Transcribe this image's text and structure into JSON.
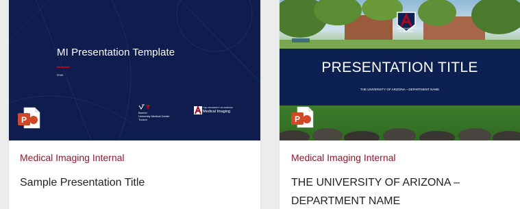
{
  "cards": [
    {
      "thumbnail": {
        "title": "MI Presentation Template",
        "date": "Date",
        "logos": {
          "banner": "Banner\nUniversity Medical Center\nTucson",
          "mi_small": "THE UNIVERSITY OF ARIZONA",
          "mi_big": "Medical Imaging"
        }
      },
      "category": "Medical Imaging Internal",
      "title": "Sample Presentation Title",
      "file_icon": "powerpoint-icon"
    },
    {
      "thumbnail": {
        "title": "PRESENTATION TITLE",
        "subtitle": "THE UNIVERSITY OF ARIZONA – DEPARTMENT NAME",
        "ua_text": "THE UNIVERSITY\nOF ARIZONA"
      },
      "category": "Medical Imaging Internal",
      "title": "THE UNIVERSITY OF ARIZONA –\nDEPARTMENT NAME",
      "file_icon": "powerpoint-icon"
    }
  ],
  "colors": {
    "navy": "#0e1d4d",
    "accent_red": "#ab0520",
    "category_text": "#8b1a2b",
    "powerpoint_orange": "#d24726"
  }
}
